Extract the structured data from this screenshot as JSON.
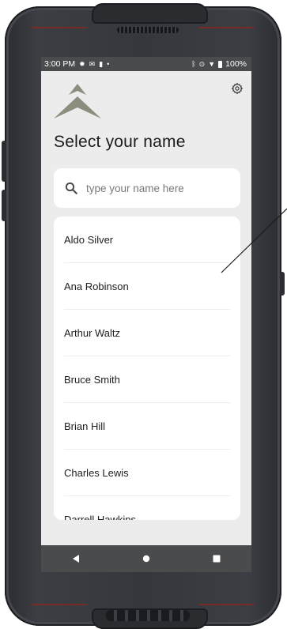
{
  "status_bar": {
    "time": "3:00 PM",
    "battery": "100%",
    "left_icons": [
      "gear-icon",
      "mail-icon",
      "sim-icon",
      "dot-icon"
    ],
    "right_icons": [
      "bluetooth-icon",
      "location-icon",
      "wifi-icon",
      "battery-icon"
    ]
  },
  "header": {
    "title": "Select your name",
    "settings_icon": "gear-icon",
    "logo": "chevron-logo"
  },
  "search": {
    "placeholder": "type your name here",
    "value": ""
  },
  "names": [
    "Aldo Silver",
    "Ana Robinson",
    "Arthur Waltz",
    "Bruce Smith",
    "Brian Hill",
    "Charles Lewis",
    "Darrell Hawkins"
  ],
  "nav_bar": {
    "buttons": [
      "back-icon",
      "home-icon",
      "recents-icon"
    ]
  },
  "colors": {
    "screen_background": "#ececec",
    "bar_background": "#4a4b4d",
    "logo_color": "#8b8e7f",
    "device_body": "#34373c",
    "accent": "#7a2a24"
  }
}
